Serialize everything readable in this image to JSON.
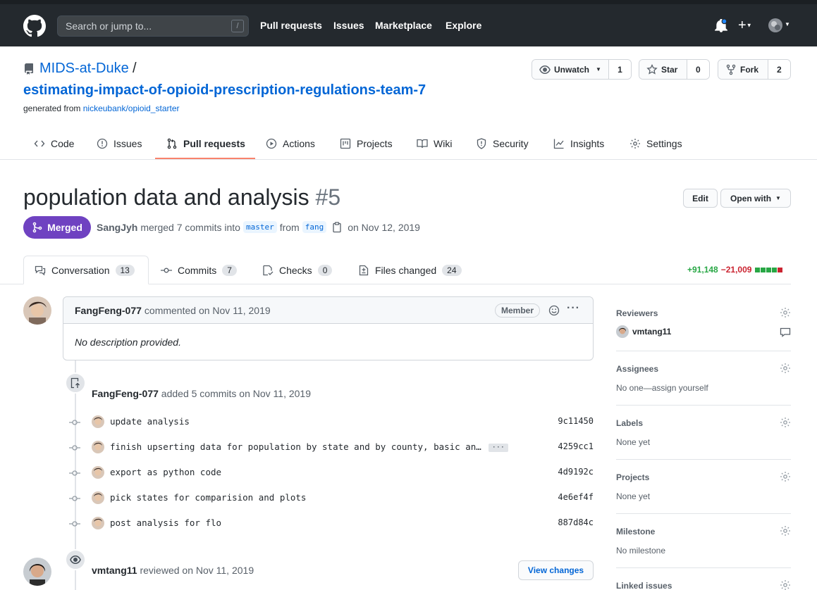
{
  "header": {
    "search_placeholder": "Search or jump to...",
    "search_key": "/",
    "nav": [
      "Pull requests",
      "Issues",
      "Marketplace",
      "Explore"
    ]
  },
  "repo": {
    "owner": "MIDS-at-Duke",
    "separator": "/",
    "name": "estimating-impact-of-opioid-prescription-regulations-team-7",
    "generated_prefix": "generated from",
    "generated_source": "nickeubank/opioid_starter",
    "unwatch_label": "Unwatch",
    "unwatch_count": "1",
    "star_label": "Star",
    "star_count": "0",
    "fork_label": "Fork",
    "fork_count": "2"
  },
  "repo_tabs": [
    {
      "label": "Code",
      "icon": "code-icon"
    },
    {
      "label": "Issues",
      "icon": "issue-icon"
    },
    {
      "label": "Pull requests",
      "icon": "pull-request-icon"
    },
    {
      "label": "Actions",
      "icon": "play-icon"
    },
    {
      "label": "Projects",
      "icon": "project-icon"
    },
    {
      "label": "Wiki",
      "icon": "book-icon"
    },
    {
      "label": "Security",
      "icon": "shield-icon"
    },
    {
      "label": "Insights",
      "icon": "graph-icon"
    },
    {
      "label": "Settings",
      "icon": "gear-icon"
    }
  ],
  "pr": {
    "title": "population data and analysis",
    "number": "#5",
    "edit_label": "Edit",
    "open_with_label": "Open with",
    "state": "Merged",
    "author": "SangJyh",
    "merged_text": "merged 7 commits into",
    "base_branch": "master",
    "from_text": "from",
    "head_branch": "fang",
    "date_text": "on Nov 12, 2019"
  },
  "pr_tabs": [
    {
      "label": "Conversation",
      "count": "13"
    },
    {
      "label": "Commits",
      "count": "7"
    },
    {
      "label": "Checks",
      "count": "0"
    },
    {
      "label": "Files changed",
      "count": "24"
    }
  ],
  "diffstat": {
    "additions": "+91,148",
    "deletions": "−21,009",
    "green_blocks": 4,
    "red_blocks": 1,
    "gray_blocks": 0
  },
  "comment": {
    "author": "FangFeng-077",
    "action": "commented on Nov 11, 2019",
    "role": "Member",
    "body": "No description provided."
  },
  "commits_event": {
    "author": "FangFeng-077",
    "action": "added 5 commits on Nov 11, 2019"
  },
  "commits": [
    {
      "message": "update analysis",
      "sha": "9c11450"
    },
    {
      "message": "finish upserting data for population by state and by county, basic an…",
      "sha": "4259cc1",
      "truncated": true
    },
    {
      "message": "export as python code",
      "sha": "4d9192c"
    },
    {
      "message": "pick states for comparision and plots",
      "sha": "4e6ef4f"
    },
    {
      "message": "post analysis for flo",
      "sha": "887d84c"
    }
  ],
  "review_event": {
    "author": "vmtang11",
    "action": "reviewed on Nov 11, 2019",
    "button": "View changes"
  },
  "sidebar": {
    "reviewers_title": "Reviewers",
    "reviewer": "vmtang11",
    "assignees_title": "Assignees",
    "assignees_value": "No one—assign yourself",
    "labels_title": "Labels",
    "labels_value": "None yet",
    "projects_title": "Projects",
    "projects_value": "None yet",
    "milestone_title": "Milestone",
    "milestone_value": "No milestone",
    "linked_title": "Linked issues"
  },
  "colors": {
    "header_bg": "#24292e",
    "merged": "#6f42c1",
    "link": "#0366d6",
    "additions": "#28a745",
    "deletions": "#cb2431",
    "tab_underline": "#f9826c"
  }
}
